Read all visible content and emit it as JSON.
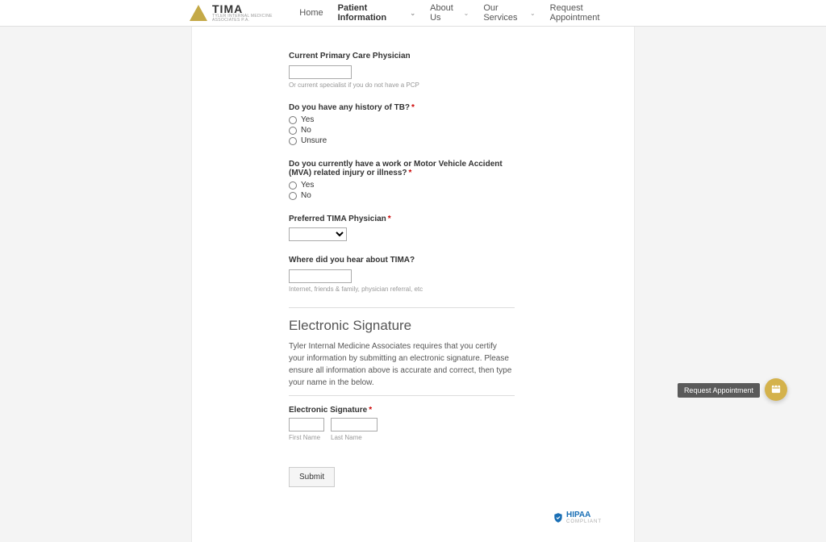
{
  "header": {
    "logo_title": "TIMA",
    "logo_sub": "TYLER INTERNAL MEDICINE ASSOCIATES P.A.",
    "nav": {
      "home": "Home",
      "patient_info": "Patient Information",
      "about": "About Us",
      "services": "Our Services",
      "request": "Request Appointment"
    }
  },
  "form": {
    "primary_care": {
      "label": "Current Primary Care Physician",
      "helper": "Or current specialist if you do not have a PCP"
    },
    "tb_history": {
      "label": "Do you have any history of TB?",
      "options": {
        "yes": "Yes",
        "no": "No",
        "unsure": "Unsure"
      }
    },
    "mva": {
      "label": "Do you currently have a work or Motor Vehicle Accident (MVA) related injury or illness?",
      "options": {
        "yes": "Yes",
        "no": "No"
      }
    },
    "preferred": {
      "label": "Preferred TIMA Physician"
    },
    "hear_about": {
      "label": "Where did you hear about TIMA?",
      "helper": "Internet, friends & family, physician referral, etc"
    },
    "signature_section": {
      "title": "Electronic Signature",
      "desc": "Tyler Internal Medicine Associates requires that you certify your information by submitting an electronic signature. Please ensure all information above is accurate and correct, then type your name in the below.",
      "field_label": "Electronic Signature",
      "first_name_label": "First Name",
      "last_name_label": "Last Name"
    },
    "submit": "Submit"
  },
  "hipaa": "HIPAA",
  "hipaa_sub": "COMPLIANT",
  "fab_label": "Request Appointment"
}
